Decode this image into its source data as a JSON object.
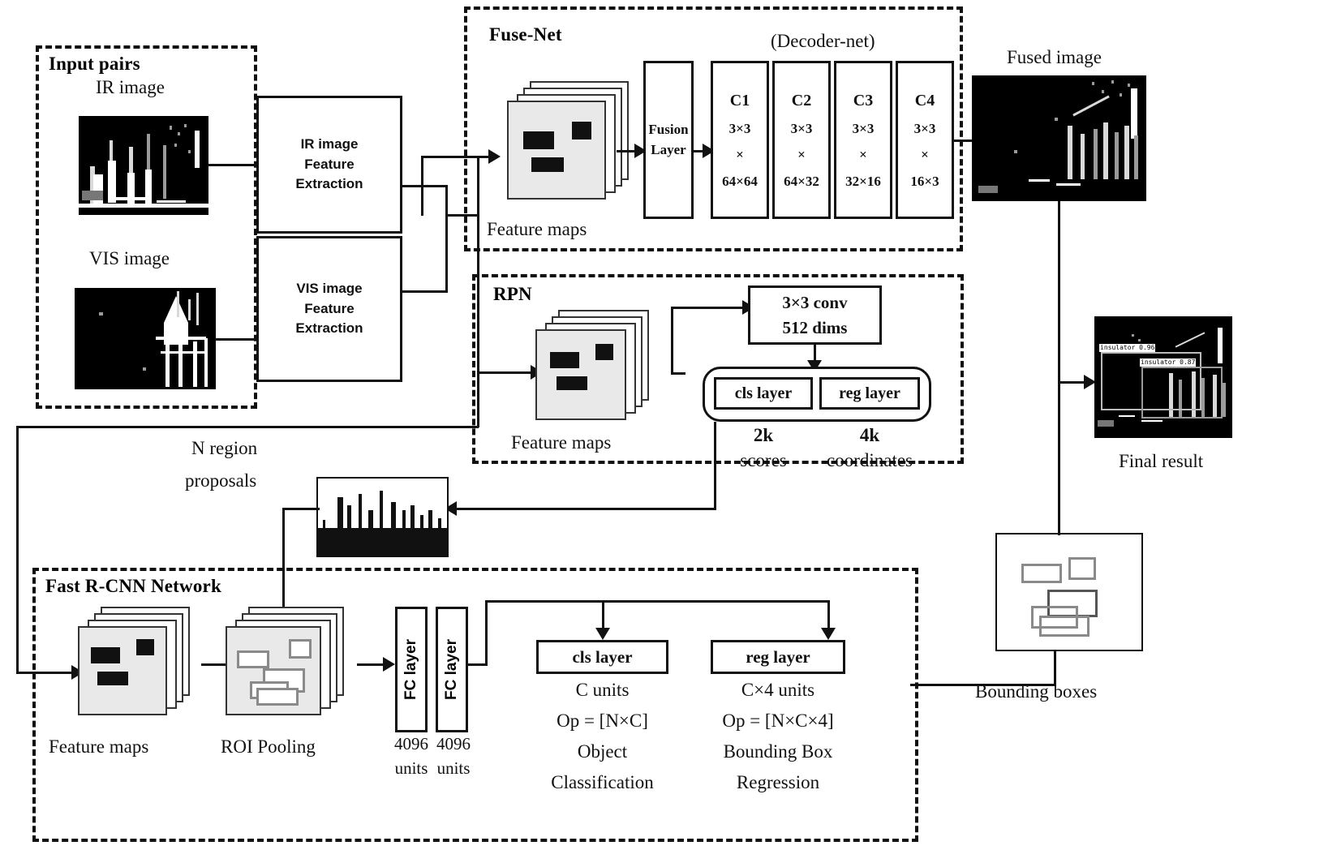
{
  "groups": {
    "input_pairs": {
      "label": "Input pairs"
    },
    "fuse_net": {
      "label": "Fuse-Net"
    },
    "rpn": {
      "label": "RPN"
    },
    "fast_rcnn": {
      "label": "Fast R-CNN Network"
    }
  },
  "input": {
    "ir_caption": "IR  image",
    "vis_caption": "VIS  image",
    "ir_extraction": [
      "IR image",
      "Feature",
      "Extraction"
    ],
    "vis_extraction": [
      "VIS image",
      "Feature",
      "Extraction"
    ]
  },
  "fuse": {
    "feature_maps_caption": "Feature maps",
    "fusion_layer": [
      "Fusion",
      "Layer"
    ],
    "decoder_caption": "(Decoder-net)",
    "conv_blocks": [
      {
        "name": "C1",
        "kernel": "3×3",
        "times": "×",
        "channels": "64×64"
      },
      {
        "name": "C2",
        "kernel": "3×3",
        "times": "×",
        "channels": "64×32"
      },
      {
        "name": "C3",
        "kernel": "3×3",
        "times": "×",
        "channels": "32×16"
      },
      {
        "name": "C4",
        "kernel": "3×3",
        "times": "×",
        "channels": "16×3"
      }
    ],
    "fused_caption": "Fused image"
  },
  "rpn": {
    "feature_maps_caption": "Feature maps",
    "conv": [
      "3×3 conv",
      "512 dims"
    ],
    "cls_layer": "cls layer",
    "reg_layer": "reg layer",
    "cls_units": [
      "2k",
      "scores"
    ],
    "reg_units": [
      "4k",
      "coordinates"
    ]
  },
  "proposals": {
    "caption": [
      "N region",
      "proposals"
    ]
  },
  "fast_rcnn": {
    "feature_maps_caption": "Feature maps",
    "roi_caption": "ROI Pooling",
    "fc1_label": "FC layer",
    "fc2_label": "FC layer",
    "fc1_units": [
      "4096",
      "units"
    ],
    "fc2_units": [
      "4096",
      "units"
    ],
    "cls_layer": "cls layer",
    "reg_layer": "reg layer",
    "cls_desc": [
      "C units",
      "Op = [N×C]",
      "Object",
      "Classification"
    ],
    "reg_desc": [
      "C×4 units",
      "Op = [N×C×4]",
      "Bounding Box",
      "Regression"
    ]
  },
  "outputs": {
    "bounding_boxes_caption": "Bounding boxes",
    "final_result_caption": "Final  result",
    "detections": [
      {
        "label": "insulator 0.96"
      },
      {
        "label": "insulator 0.87"
      }
    ]
  },
  "colors": {
    "stroke": "#111111",
    "fill": "#ffffff",
    "face_shade": "#e9e9e9",
    "side_shade": "#dedede",
    "hollow_box": "#8a8a8a"
  }
}
